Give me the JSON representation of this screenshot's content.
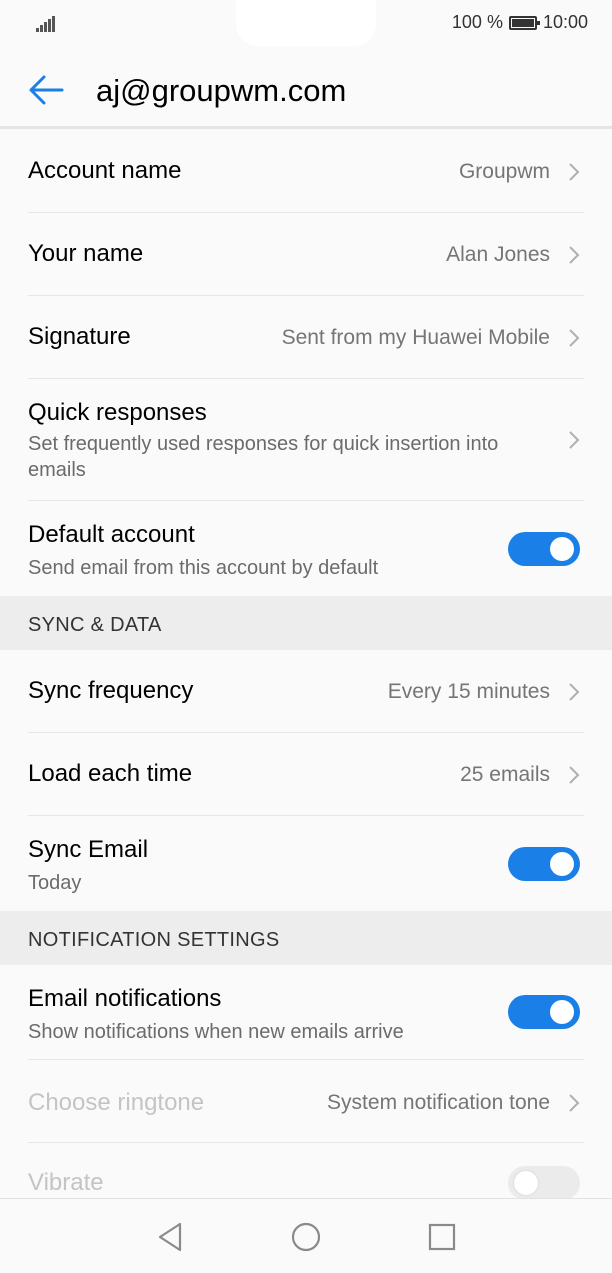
{
  "status": {
    "battery_text": "100 %",
    "time": "10:00"
  },
  "header": {
    "title": "aj@groupwm.com",
    "back_icon": "arrow-left-icon"
  },
  "colors": {
    "accent": "#1a7fe6",
    "toggle_off": "#ebebeb",
    "section_bg": "#ededed"
  },
  "account": {
    "account_name": {
      "label": "Account name",
      "value": "Groupwm"
    },
    "your_name": {
      "label": "Your name",
      "value": "Alan Jones"
    },
    "signature": {
      "label": "Signature",
      "value": "Sent from my Huawei Mobile"
    },
    "quick_responses": {
      "label": "Quick responses",
      "desc": "Set frequently used responses for quick insertion into emails"
    },
    "default_account": {
      "label": "Default account",
      "desc": "Send email from this account by default",
      "enabled": true
    }
  },
  "sync_section": {
    "header": "SYNC & DATA",
    "sync_frequency": {
      "label": "Sync frequency",
      "value": "Every 15 minutes"
    },
    "load_each_time": {
      "label": "Load each time",
      "value": "25 emails"
    },
    "sync_email": {
      "label": "Sync Email",
      "desc": "Today",
      "enabled": true
    }
  },
  "notification_section": {
    "header": "NOTIFICATION SETTINGS",
    "email_notifications": {
      "label": "Email notifications",
      "desc": "Show notifications when new emails arrive",
      "enabled": true
    },
    "choose_ringtone": {
      "label": "Choose ringtone",
      "value": "System notification tone"
    },
    "vibrate": {
      "label": "Vibrate",
      "enabled": false
    }
  },
  "nav": {
    "back": "nav-back-icon",
    "home": "nav-home-icon",
    "recents": "nav-recents-icon"
  }
}
